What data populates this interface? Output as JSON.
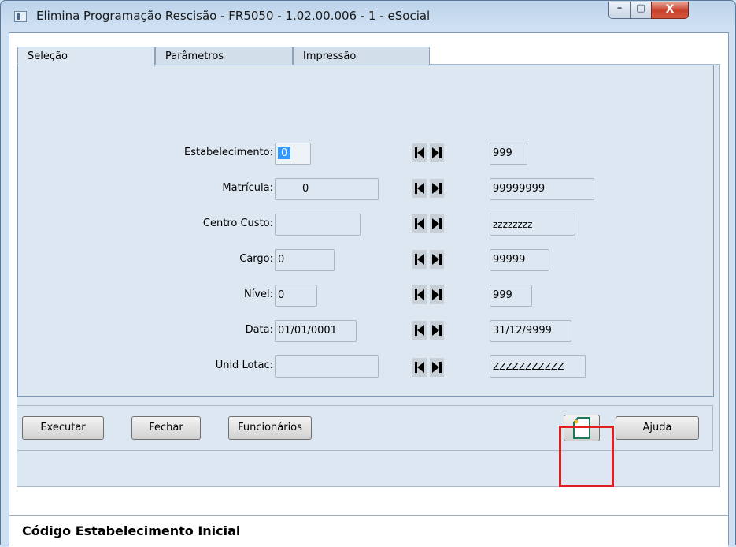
{
  "window": {
    "title": "Elimina Programação Rescisão - FR5050 - 1.02.00.006 - 1 - eSocial",
    "minimize_glyph": "–",
    "maximize_glyph": "▢",
    "close_glyph": "X"
  },
  "tabs": [
    {
      "label": "Seleção",
      "active": true
    },
    {
      "label": "Parâmetros",
      "active": false
    },
    {
      "label": "Impressão",
      "active": false
    }
  ],
  "fields": [
    {
      "label": "Estabelecimento:",
      "initial": "0",
      "final": "999"
    },
    {
      "label": "Matrícula:",
      "initial": "0",
      "final": "99999999"
    },
    {
      "label": "Centro Custo:",
      "initial": "",
      "final": "zzzzzzzz"
    },
    {
      "label": "Cargo:",
      "initial": "0",
      "final": "99999"
    },
    {
      "label": "Nível:",
      "initial": "0",
      "final": "999"
    },
    {
      "label": "Data:",
      "initial": "01/01/0001",
      "final": "31/12/9999"
    },
    {
      "label": "Unid Lotac:",
      "initial": "",
      "final": "ZZZZZZZZZZZ"
    }
  ],
  "buttons": {
    "executar": "Executar",
    "fechar": "Fechar",
    "funcionarios": "Funcionários",
    "ajuda": "Ajuda"
  },
  "icons": {
    "first": "first-record-icon",
    "last": "last-record-icon",
    "document": "document-icon"
  },
  "status": "Código Estabelecimento Inicial",
  "colors": {
    "panel": "#dde7f1",
    "selection": "#3399ff",
    "highlight": "#e02020"
  }
}
